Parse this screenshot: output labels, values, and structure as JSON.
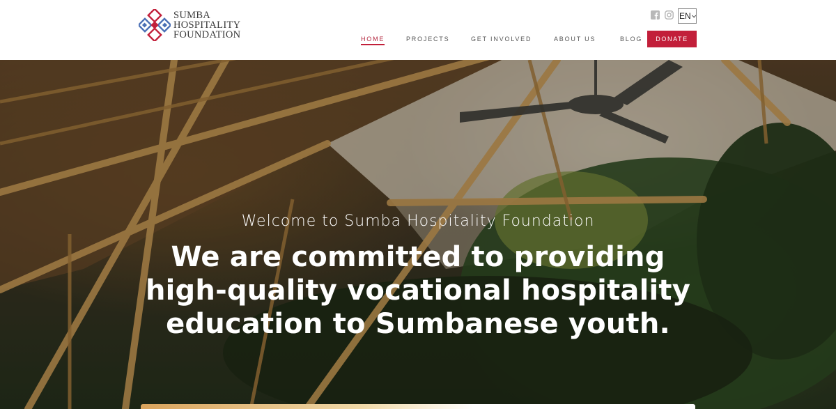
{
  "brand": {
    "line1": "SUMBA",
    "line2": "HOSPITALITY",
    "line3": "FOUNDATION",
    "colors": {
      "red": "#c21f3a",
      "blue": "#4a6fb5"
    }
  },
  "socials": [
    {
      "name": "facebook-icon"
    },
    {
      "name": "instagram-icon"
    }
  ],
  "language": {
    "selected": "EN"
  },
  "nav": {
    "items": [
      {
        "label": "HOME",
        "active": true
      },
      {
        "label": "PROJECTS",
        "active": false
      },
      {
        "label": "GET INVOLVED",
        "active": false
      },
      {
        "label": "ABOUT US",
        "active": false
      },
      {
        "label": "BLOG",
        "active": false
      }
    ],
    "donate_label": "DONATE",
    "accent": "#c21f3a"
  },
  "hero": {
    "welcome": "Welcome to Sumba Hospitality Foundation",
    "headline": "We are committed to providing high-quality vocational hospitality education to Sumbanese youth."
  }
}
